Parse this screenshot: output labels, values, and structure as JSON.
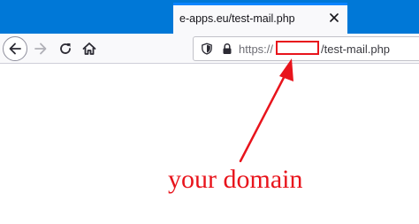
{
  "browser": {
    "tab": {
      "title": "e-apps.eu/test-mail.php",
      "close_icon": "close-icon"
    },
    "toolbar": {
      "back_icon": "arrow-left-icon",
      "forward_icon": "arrow-right-icon",
      "reload_icon": "reload-icon",
      "home_icon": "home-icon"
    },
    "urlbar": {
      "shield_icon": "shield-icon",
      "lock_icon": "lock-icon",
      "protocol": "https://",
      "path": "/test-mail.php"
    }
  },
  "annotation": {
    "label": "your domain",
    "color": "#e8141c"
  },
  "colors": {
    "titlebar": "#0078d7",
    "tab_accent": "#0a84ff",
    "toolbar_bg": "#f9f9fb"
  }
}
